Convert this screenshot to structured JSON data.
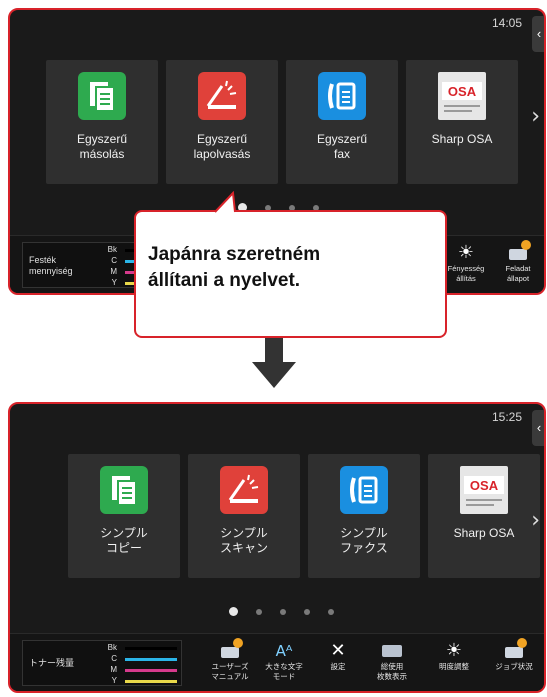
{
  "before": {
    "clock": "14:05",
    "tiles": [
      {
        "label": "Egyszerű\nmásolás",
        "icon": "copy-icon"
      },
      {
        "label": "Egyszerű\nlapolvasás",
        "icon": "scanner-icon"
      },
      {
        "label": "Egyszerű\nfax",
        "icon": "fax-icon"
      },
      {
        "label": "Sharp OSA",
        "icon": "osa-icon"
      }
    ],
    "osa_logo": "OSA",
    "toner_label": "Festék\nmennyiség",
    "toner_codes": [
      "Bk",
      "C",
      "M",
      "Y"
    ],
    "tool_labels": [
      "Fényesség\nállítás",
      "Feladat\nállapot"
    ]
  },
  "callout": "Japánra szeretném\nállítani a nyelvet.",
  "after": {
    "clock": "15:25",
    "tiles": [
      {
        "label": "シンプル\nコピー",
        "icon": "copy-icon"
      },
      {
        "label": "シンプル\nスキャン",
        "icon": "scanner-icon"
      },
      {
        "label": "シンプル\nファクス",
        "icon": "fax-icon"
      },
      {
        "label": "Sharp OSA",
        "icon": "osa-icon"
      }
    ],
    "osa_logo": "OSA",
    "toner_label": "トナー残量",
    "toner_codes": [
      "Bk",
      "C",
      "M",
      "Y"
    ],
    "tools": [
      {
        "label": "ユーザーズ\nマニュアル",
        "icon": "manual-icon"
      },
      {
        "label": "大きな文字\nモード",
        "icon": "large-text-icon",
        "glyph": "Aᴬ"
      },
      {
        "label": "設定",
        "icon": "settings-icon",
        "glyph": "✕"
      },
      {
        "label": "総使用\n枚数表示",
        "icon": "counter-icon"
      },
      {
        "label": "明度調整",
        "icon": "brightness-icon",
        "glyph": "☀"
      },
      {
        "label": "ジョブ状況",
        "icon": "job-status-icon"
      }
    ]
  },
  "colors": {
    "frame": "#d8232a",
    "toner_bk": "#000000",
    "toner_c": "#2bb5e8",
    "toner_m": "#d63a8c",
    "toner_y": "#e9d84a"
  }
}
